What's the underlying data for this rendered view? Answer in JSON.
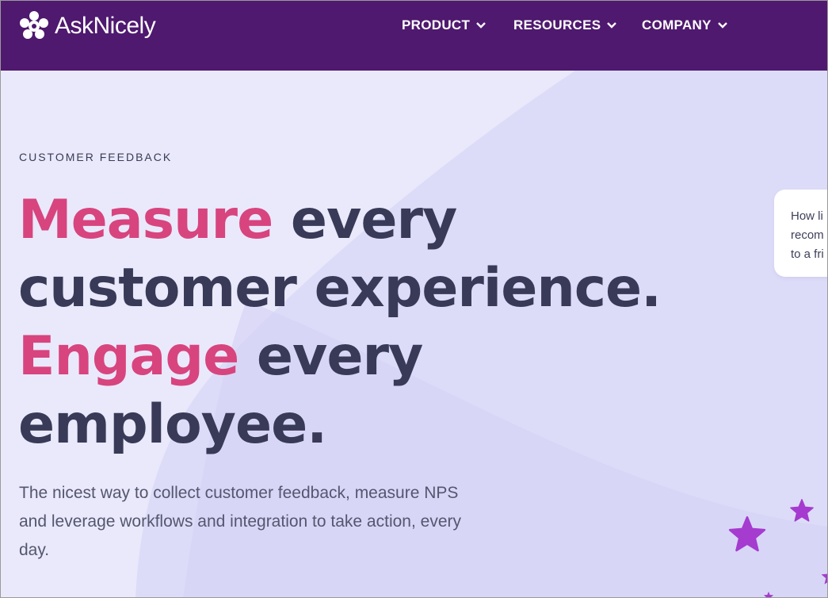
{
  "nav": {
    "brand": "AskNicely",
    "items": [
      {
        "label": "PRODUCT"
      },
      {
        "label": "RESOURCES"
      },
      {
        "label": "COMPANY"
      }
    ]
  },
  "hero": {
    "eyebrow": "CUSTOMER FEEDBACK",
    "headline": {
      "line1_accent": "Measure",
      "line1_rest": " every",
      "line2": "customer experience.",
      "line3_accent": "Engage",
      "line3_rest": " every",
      "line4": "employee."
    },
    "subtext": "The nicest way to collect customer feedback, measure NPS and leverage workflows and integration to take action, every day."
  },
  "survey_card": {
    "text": "How li\nrecom\nto a fri"
  },
  "colors": {
    "nav_bg": "#4f196f",
    "accent_pink": "#d8447e",
    "headline": "#383a57",
    "star_purple": "#a53bcf"
  }
}
